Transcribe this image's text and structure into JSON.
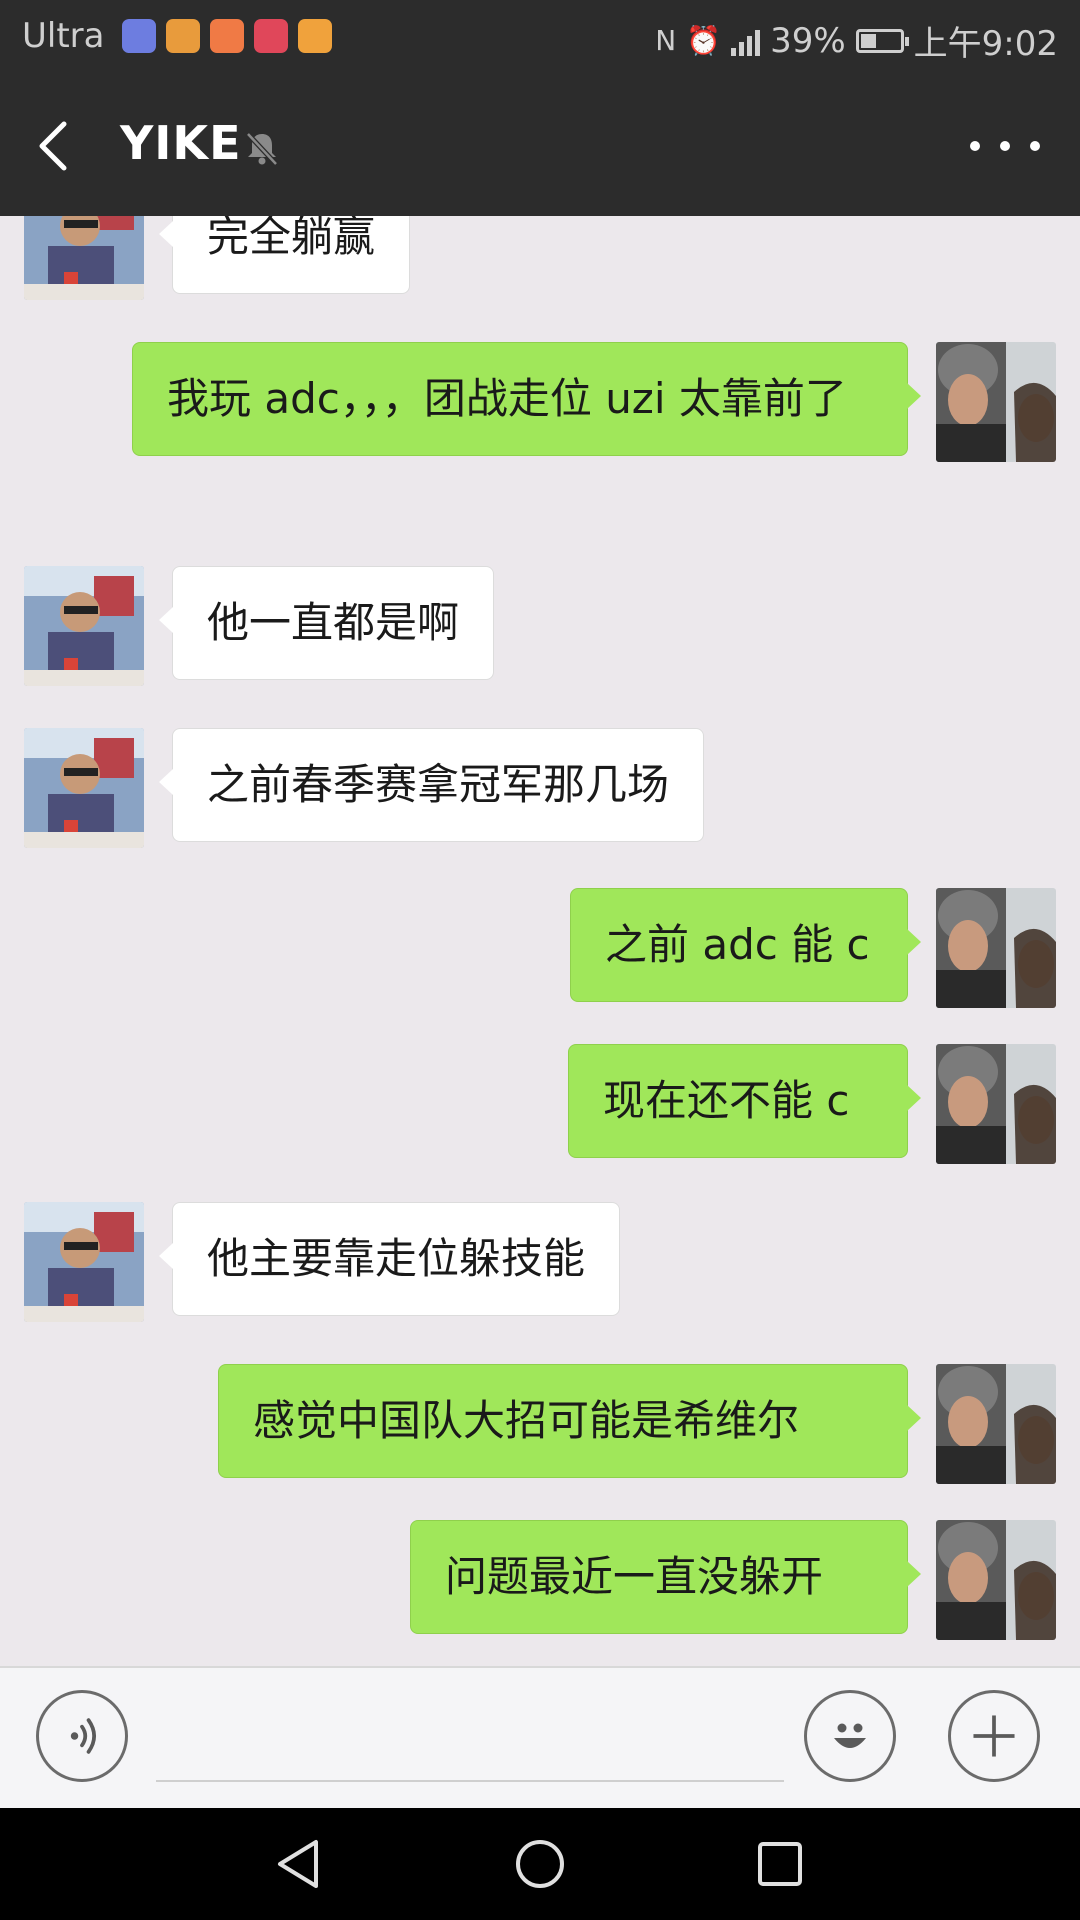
{
  "status_bar": {
    "carrier": "Ultra",
    "battery": "39%",
    "battery_level": 0.39,
    "time": "上午9:02",
    "app_icons": [
      {
        "name": "video-app-icon",
        "color": "#6d7de0"
      },
      {
        "name": "wallet-app-icon",
        "color": "#e89b3c"
      },
      {
        "name": "health-app-icon",
        "color": "#f07a45"
      },
      {
        "name": "reader-app-icon",
        "color": "#e0475a"
      },
      {
        "name": "player-app-icon",
        "color": "#f0a23c"
      }
    ]
  },
  "header": {
    "title": "YIKE",
    "muted": true
  },
  "colors": {
    "outgoing_bubble": "#a0e75a",
    "incoming_bubble": "#ffffff",
    "bar_background": "#2c2c2c",
    "chat_background": "#ece8ec"
  },
  "messages": [
    {
      "side": "in",
      "text": "完全躺赢"
    },
    {
      "side": "out",
      "text": "我玩 adc，，，团战走位 uzi 太靠前了"
    },
    {
      "side": "in",
      "text": "他一直都是啊"
    },
    {
      "side": "in",
      "text": "之前春季赛拿冠军那几场"
    },
    {
      "side": "out",
      "text": "之前 adc 能 c"
    },
    {
      "side": "out",
      "text": "现在还不能 c"
    },
    {
      "side": "in",
      "text": "他主要靠走位躲技能"
    },
    {
      "side": "out",
      "text": "感觉中国队大招可能是希维尔"
    },
    {
      "side": "out",
      "text": "问题最近一直没躲开"
    }
  ],
  "input": {
    "value": "",
    "placeholder": ""
  }
}
